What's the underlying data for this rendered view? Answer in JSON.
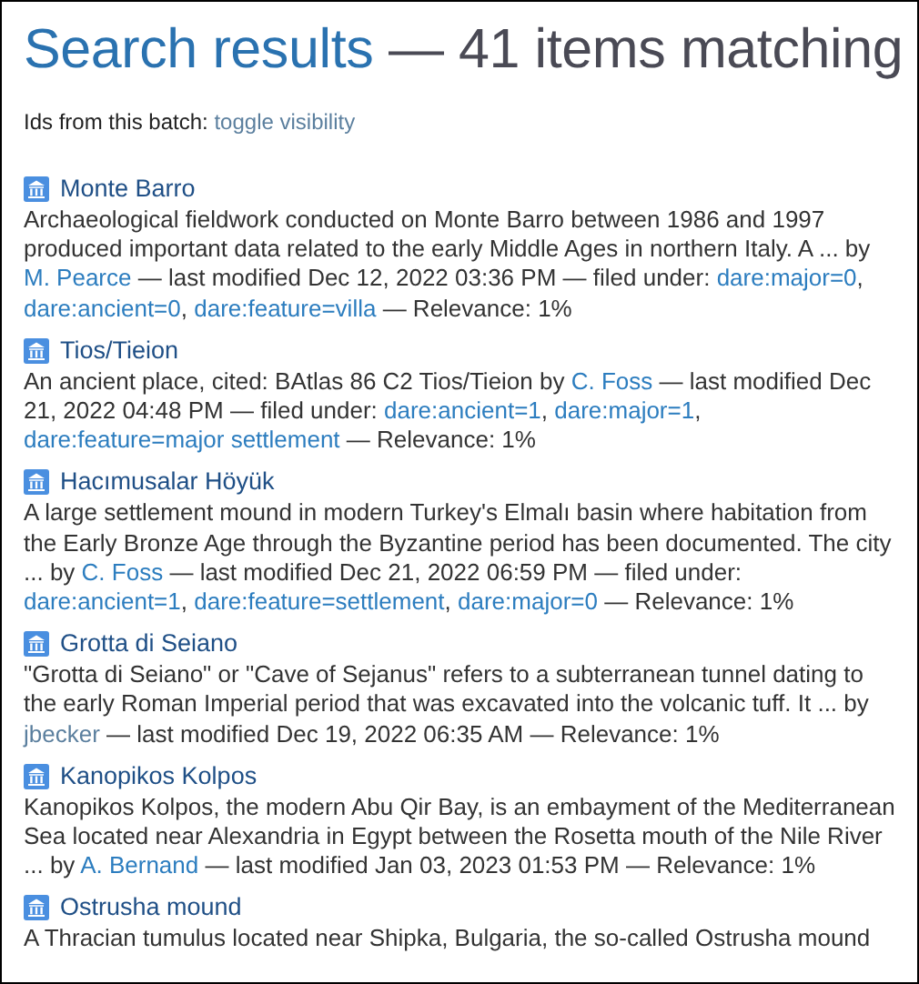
{
  "heading": {
    "title": "Search results",
    "count": "— 41 items matching"
  },
  "batch_line": {
    "label": "Ids from this batch:",
    "link": "toggle visibility"
  },
  "results": [
    {
      "title": "Monte Barro",
      "segments": [
        {
          "kind": "text",
          "text": "Archaeological fieldwork conducted on Monte Barro between 1986 and 1997 produced important data related to the early Middle Ages in northern Italy. A ... by "
        },
        {
          "kind": "author",
          "text": "M. Pearce"
        },
        {
          "kind": "text",
          "text": " — last modified Dec 12, 2022 03:36 PM — filed under: "
        },
        {
          "kind": "tag",
          "text": "dare:major=0"
        },
        {
          "kind": "text",
          "text": ", "
        },
        {
          "kind": "tag",
          "text": "dare:ancient=0"
        },
        {
          "kind": "text",
          "text": ", "
        },
        {
          "kind": "tag",
          "text": "dare:feature=villa"
        },
        {
          "kind": "text",
          "text": " — Relevance: 1%"
        }
      ]
    },
    {
      "title": "Tios/Tieion",
      "segments": [
        {
          "kind": "text",
          "text": "An ancient place, cited: BAtlas 86 C2 Tios/Tieion by "
        },
        {
          "kind": "author",
          "text": "C. Foss"
        },
        {
          "kind": "text",
          "text": " — last modified Dec 21, 2022 04:48 PM — filed under: "
        },
        {
          "kind": "tag",
          "text": "dare:ancient=1"
        },
        {
          "kind": "text",
          "text": ", "
        },
        {
          "kind": "tag",
          "text": "dare:major=1"
        },
        {
          "kind": "text",
          "text": ", "
        },
        {
          "kind": "tag",
          "text": "dare:feature=major settlement"
        },
        {
          "kind": "text",
          "text": " — Relevance: 1%"
        }
      ]
    },
    {
      "title": "Hacımusalar Höyük",
      "segments": [
        {
          "kind": "text",
          "text": "A large settlement mound in modern Turkey's Elmalı basin where habitation from the Early Bronze Age through the Byzantine period has been documented. The city ... by "
        },
        {
          "kind": "author",
          "text": "C. Foss"
        },
        {
          "kind": "text",
          "text": " — last modified Dec 21, 2022 06:59 PM — filed under: "
        },
        {
          "kind": "tag",
          "text": "dare:ancient=1"
        },
        {
          "kind": "text",
          "text": ", "
        },
        {
          "kind": "tag",
          "text": "dare:feature=settlement"
        },
        {
          "kind": "text",
          "text": ", "
        },
        {
          "kind": "tag",
          "text": "dare:major=0"
        },
        {
          "kind": "text",
          "text": " — Relevance: 1%"
        }
      ]
    },
    {
      "title": "Grotta di Seiano",
      "segments": [
        {
          "kind": "text",
          "text": "\"Grotta di Seiano\" or \"Cave of Sejanus\" refers to a subterranean tunnel dating to the early Roman Imperial period that was excavated into the volcanic tuff. It ... by "
        },
        {
          "kind": "visited_author",
          "text": "jbecker"
        },
        {
          "kind": "text",
          "text": " — last modified Dec 19, 2022 06:35 AM — Relevance: 1%"
        }
      ]
    },
    {
      "title": "Kanopikos Kolpos",
      "segments": [
        {
          "kind": "text",
          "text": "Kanopikos Kolpos, the modern Abu Qir Bay, is an embayment of the Mediterranean Sea located near Alexandria in Egypt between the Rosetta mouth of the Nile River ... by "
        },
        {
          "kind": "author",
          "text": "A. Bernand"
        },
        {
          "kind": "text",
          "text": " — last modified Jan 03, 2023 01:53 PM — Relevance: 1%"
        }
      ]
    },
    {
      "title": "Ostrusha mound",
      "segments": [
        {
          "kind": "text",
          "text": "A Thracian tumulus located near Shipka, Bulgaria, the so-called Ostrusha mound"
        }
      ]
    }
  ]
}
